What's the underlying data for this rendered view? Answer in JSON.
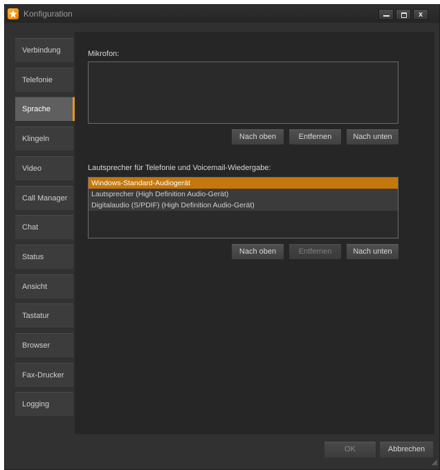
{
  "window": {
    "title": "Konfiguration",
    "min_glyph": "",
    "max_glyph": "",
    "close_glyph": "x"
  },
  "sidebar": {
    "items": [
      {
        "label": "Verbindung"
      },
      {
        "label": "Telefonie"
      },
      {
        "label": "Sprache",
        "active": true
      },
      {
        "label": "Klingeln"
      },
      {
        "label": "Video"
      },
      {
        "label": "Call Manager"
      },
      {
        "label": "Chat"
      },
      {
        "label": "Status"
      },
      {
        "label": "Ansicht"
      },
      {
        "label": "Tastatur"
      },
      {
        "label": "Browser"
      },
      {
        "label": "Fax-Drucker"
      },
      {
        "label": "Logging"
      }
    ]
  },
  "microphone": {
    "label": "Mikrofon:",
    "items": [],
    "buttons": {
      "up": "Nach oben",
      "remove": "Entfernen",
      "down": "Nach unten"
    }
  },
  "speaker": {
    "label": "Lautsprecher für Telefonie und Voicemail-Wiedergabe:",
    "items": [
      {
        "label": "Windows-Standard-Audiogerät",
        "selected": true
      },
      {
        "label": "Lautsprecher (High Definition Audio-Gerät)"
      },
      {
        "label": "Digitalaudio (S/PDIF) (High Definition Audio-Gerät)"
      }
    ],
    "buttons": {
      "up": "Nach oben",
      "remove": "Entfernen",
      "down": "Nach unten"
    }
  },
  "footer": {
    "ok": "OK",
    "cancel": "Abbrechen"
  },
  "colors": {
    "accent": "#e8981c",
    "selection": "#c4780c",
    "background": "#313131",
    "panel": "#262626"
  },
  "icons": {
    "app": "star-logo-icon",
    "resize": "resize-grip-icon"
  }
}
